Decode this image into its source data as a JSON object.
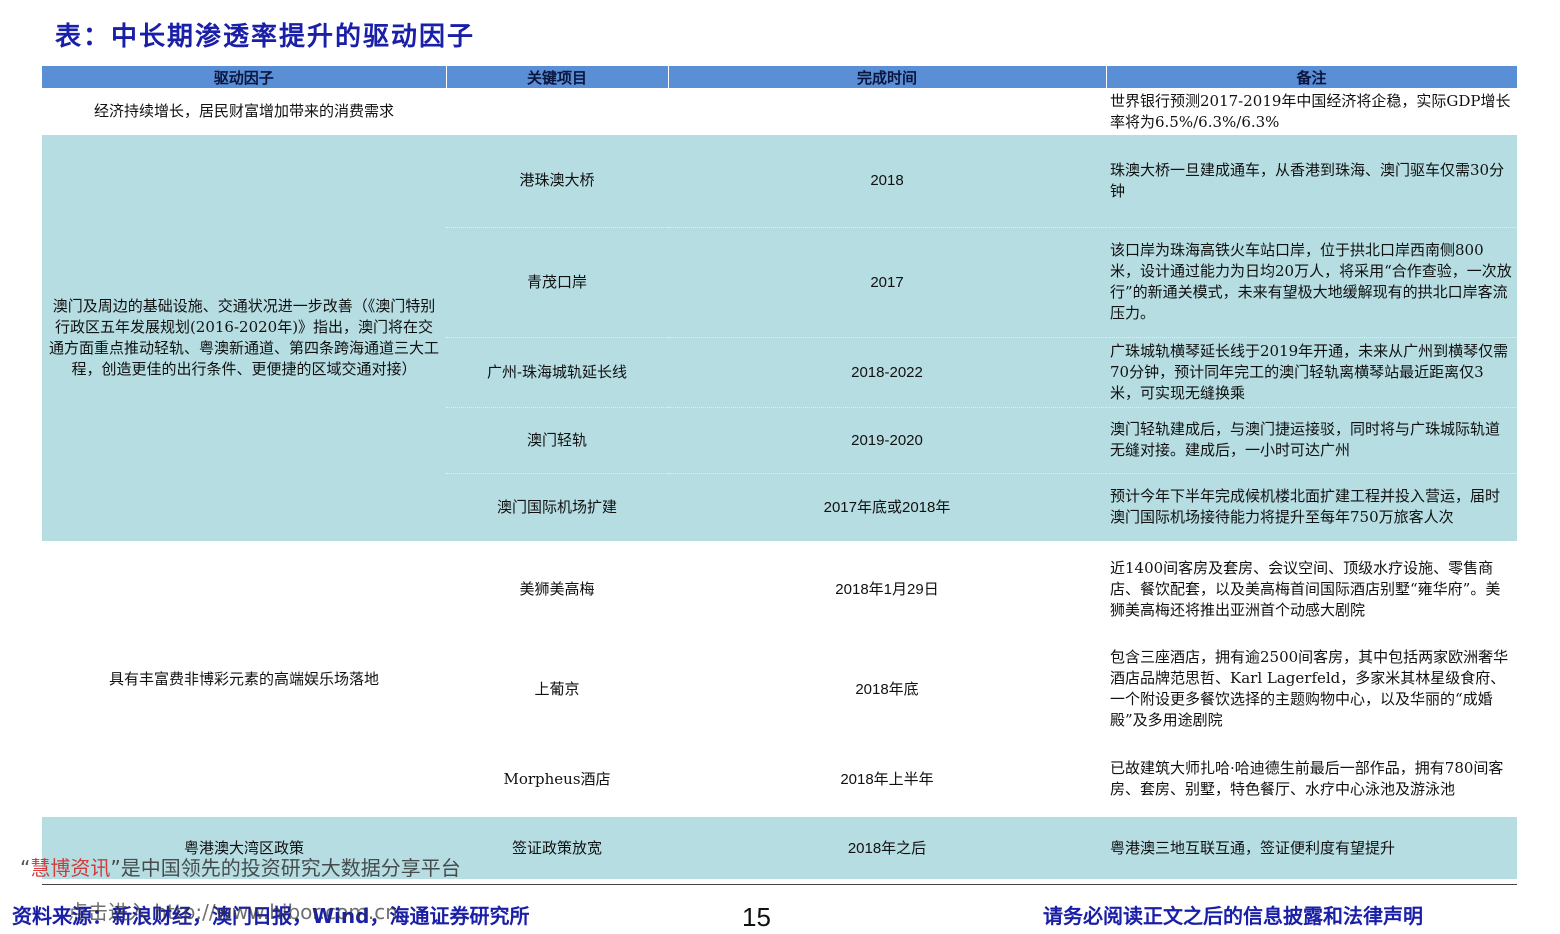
{
  "title": "表：中长期渗透率提升的驱动因子",
  "table": {
    "headers": [
      "驱动因子",
      "关键项目",
      "完成时间",
      "备注"
    ],
    "row_economy": {
      "factor": "经济持续增长，居民财富增加带来的消费需求",
      "project": "",
      "time": "",
      "note": "世界银行预测2017-2019年中国经济将企稳，实际GDP增长率将为6.5%/6.3%/6.3%"
    },
    "group_infra": {
      "factor": "澳门及周边的基础设施、交通状况进一步改善（《澳门特别行政区五年发展规划(2016-2020年)》指出，澳门将在交通方面重点推动轻轨、粤澳新通道、第四条跨海通道三大工程，创造更佳的出行条件、更便捷的区域交通对接）",
      "rows": [
        {
          "project": "港珠澳大桥",
          "time": "2018",
          "note": "珠澳大桥一旦建成通车，从香港到珠海、澳门驱车仅需30分钟"
        },
        {
          "project": "青茂口岸",
          "time": "2017",
          "note": "该口岸为珠海高铁火车站口岸，位于拱北口岸西南侧800米，设计通过能力为日均20万人，将采用“合作查验，一次放行”的新通关模式，未来有望极大地缓解现有的拱北口岸客流压力。"
        },
        {
          "project": "广州-珠海城轨延长线",
          "time": "2018-2022",
          "note": "广珠城轨横琴延长线于2019年开通，未来从广州到横琴仅需70分钟，预计同年完工的澳门轻轨离横琴站最近距离仅3米，可实现无缝换乘"
        },
        {
          "project": "澳门轻轨",
          "time": "2019-2020",
          "note": "澳门轻轨建成后，与澳门捷运接驳，同时将与广珠城际轨道无缝对接。建成后，一小时可达广州"
        },
        {
          "project": "澳门国际机场扩建",
          "time": "2017年底或2018年",
          "note": "预计今年下半年完成候机楼北面扩建工程并投入营运，届时澳门国际机场接待能力将提升至每年750万旅客人次"
        }
      ]
    },
    "group_entertainment": {
      "factor": "具有丰富费非博彩元素的高端娱乐场落地",
      "rows": [
        {
          "project": "美狮美高梅",
          "time": "2018年1月29日",
          "note": "近1400间客房及套房、会议空间、顶级水疗设施、零售商店、餐饮配套，以及美高梅首间国际酒店别墅“雍华府”。美狮美高梅还将推出亚洲首个动感大剧院"
        },
        {
          "project": "上葡京",
          "time": "2018年底",
          "note": "包含三座酒店，拥有逾2500间客房，其中包括两家欧洲奢华酒店品牌范思哲、Karl Lagerfeld，多家米其林星级食府、一个附设更多餐饮选择的主题购物中心，以及华丽的“成婚殿”及多用途剧院"
        },
        {
          "project": "Morpheus酒店",
          "time": "2018年上半年",
          "note": "已故建筑大师扎哈·哈迪德生前最后一部作品，拥有780间客房、套房、别墅，特色餐厅、水疗中心泳池及游泳池"
        }
      ]
    },
    "row_bay": {
      "factor": "粤港澳大湾区政策",
      "project": "签证政策放宽",
      "time": "2018年之后",
      "note": "粤港澳三地互联互通，签证便利度有望提升"
    }
  },
  "footer": {
    "source": "资料来源：新浪财经，澳门日报，Wind，海通证券研究所",
    "page_number": "15",
    "disclaimer": "请务必阅读正文之后的信息披露和法律声明"
  },
  "watermark": {
    "quote_open": "“",
    "brand": "慧博资讯",
    "line1_rest": "”是中国领先的投资研究大数据分享平台",
    "line2": "点击进入 http://www.hibor.com.cn"
  }
}
